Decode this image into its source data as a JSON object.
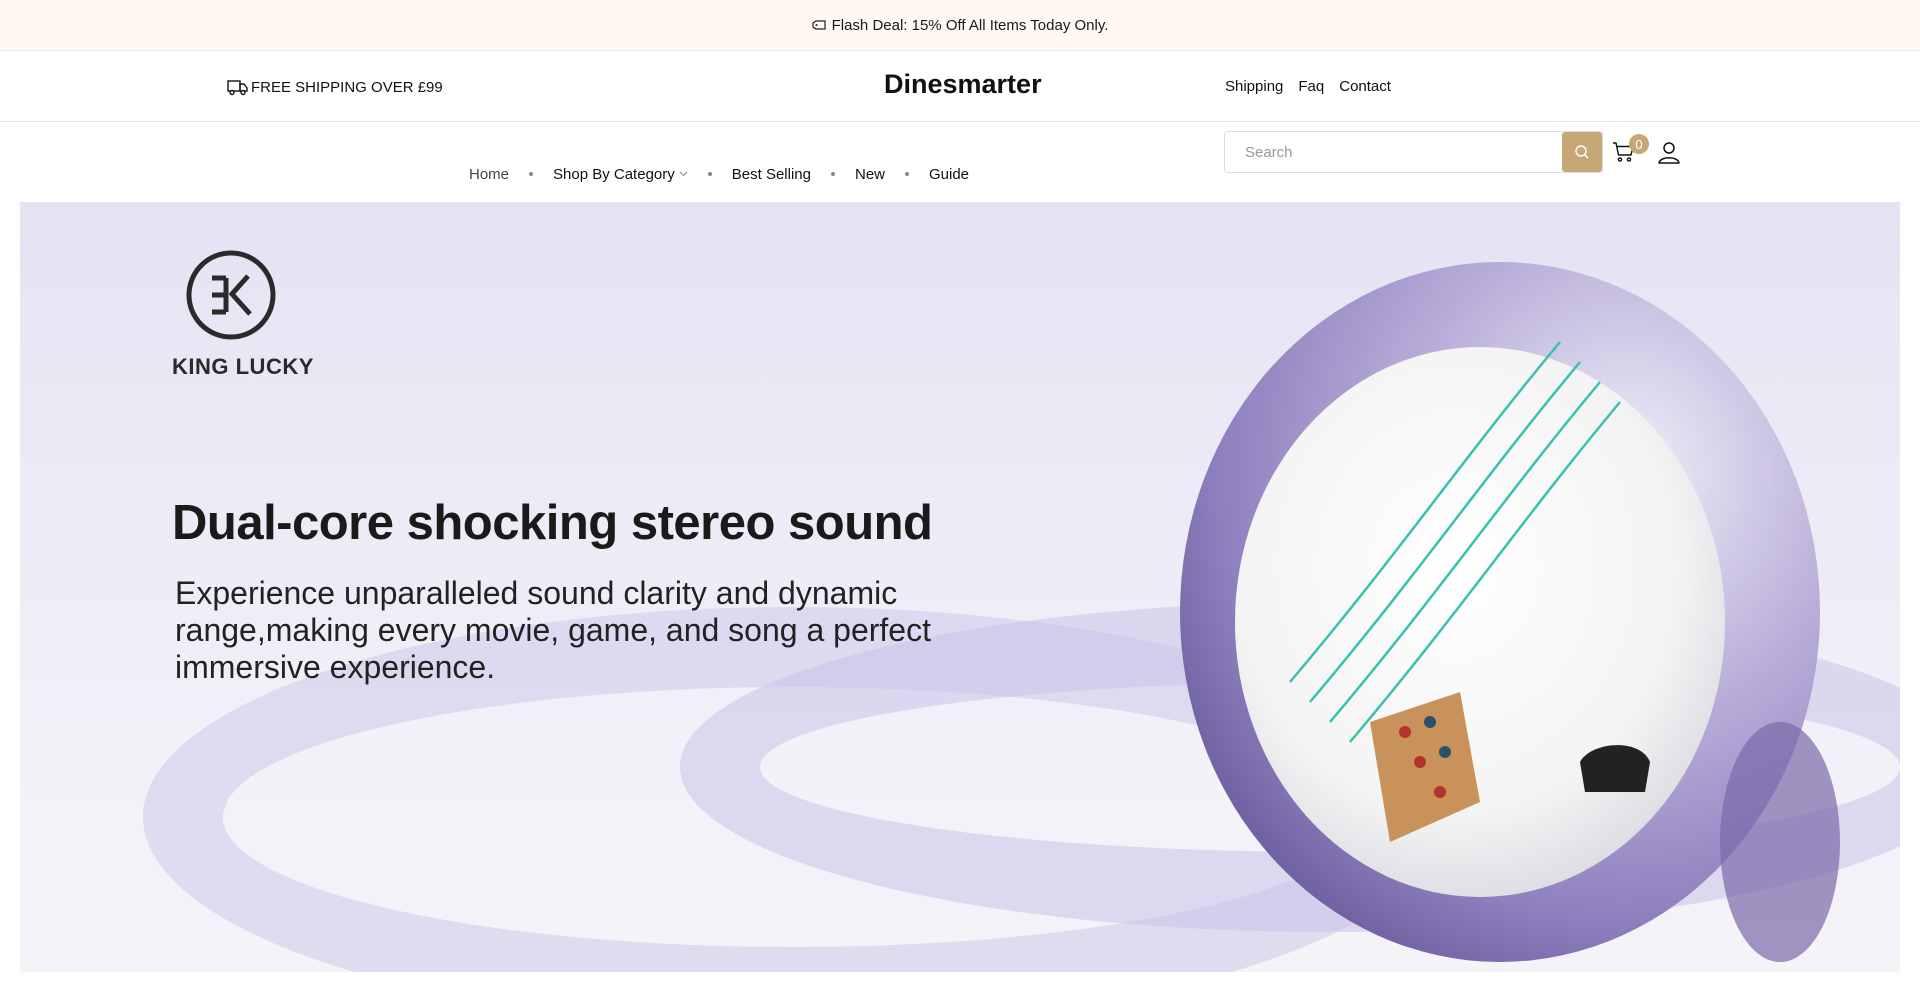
{
  "announcement": {
    "text": "Flash Deal: 15% Off All Items Today Only.",
    "icon": "tag-icon"
  },
  "header": {
    "shipping_text": "FREE SHIPPING OVER £99",
    "shipping_icon": "truck-icon",
    "brand": "Dinesmarter",
    "links": [
      "Shipping",
      "Faq",
      "Contact"
    ]
  },
  "nav": {
    "items": [
      {
        "label": "Home"
      },
      {
        "label": "Shop By Category",
        "has_dropdown": true
      },
      {
        "label": "Best Selling"
      },
      {
        "label": "New"
      },
      {
        "label": "Guide"
      }
    ]
  },
  "search": {
    "placeholder": "Search",
    "value": "",
    "button_icon": "search-icon"
  },
  "cart": {
    "count": "0",
    "icon": "cart-icon"
  },
  "account": {
    "icon": "user-icon"
  },
  "hero": {
    "logo_text": "KING LUCKY",
    "headline": "Dual-core shocking stereo sound",
    "subcopy": "Experience unparalleled sound clarity and dynamic range,making every movie, game, and song a perfect immersive experience."
  },
  "colors": {
    "accent": "#c6a877",
    "announcement_bg": "#fff8f3",
    "hero_bg": "#e9e8f5",
    "sphere_purple": "#9a8cc4"
  }
}
